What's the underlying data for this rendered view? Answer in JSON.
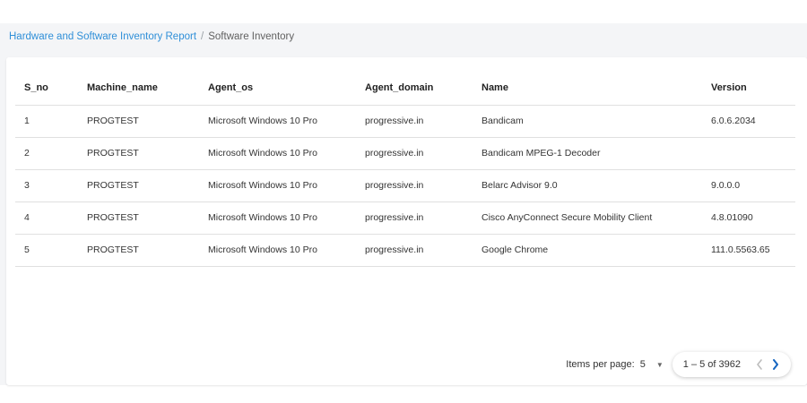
{
  "breadcrumb": {
    "parent": "Hardware and Software Inventory Report",
    "separator": "/",
    "current": "Software Inventory"
  },
  "table": {
    "headers": [
      "S_no",
      "Machine_name",
      "Agent_os",
      "Agent_domain",
      "Name",
      "Version"
    ],
    "rows": [
      [
        "1",
        "PROGTEST",
        "Microsoft Windows 10 Pro",
        "progressive.in",
        "Bandicam",
        "6.0.6.2034"
      ],
      [
        "2",
        "PROGTEST",
        "Microsoft Windows 10 Pro",
        "progressive.in",
        "Bandicam MPEG-1 Decoder",
        ""
      ],
      [
        "3",
        "PROGTEST",
        "Microsoft Windows 10 Pro",
        "progressive.in",
        "Belarc Advisor 9.0",
        "9.0.0.0"
      ],
      [
        "4",
        "PROGTEST",
        "Microsoft Windows 10 Pro",
        "progressive.in",
        "Cisco AnyConnect Secure Mobility Client",
        "4.8.01090"
      ],
      [
        "5",
        "PROGTEST",
        "Microsoft Windows 10 Pro",
        "progressive.in",
        "Google Chrome",
        "111.0.5563.65"
      ]
    ]
  },
  "paginator": {
    "items_per_page_label": "Items per page:",
    "items_per_page_value": "5",
    "range_label": "1 – 5 of 3962",
    "prev_icon": "chevron-left-icon",
    "next_icon": "chevron-right-icon"
  },
  "colors": {
    "link": "#2f8fd8",
    "page_background": "#f4f5f7",
    "prev_disabled": "#bdbdbd",
    "next_active": "#1565c0"
  }
}
